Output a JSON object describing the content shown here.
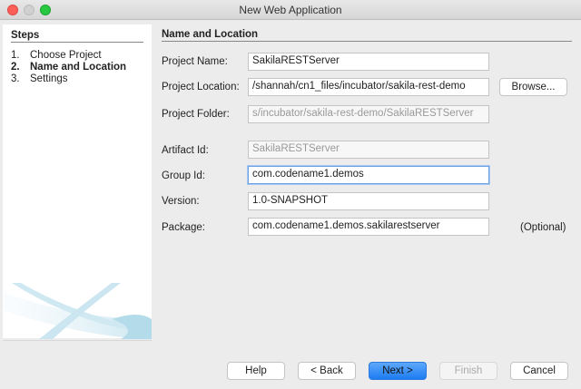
{
  "window": {
    "title": "New Web Application"
  },
  "steps": {
    "heading": "Steps",
    "items": [
      {
        "num": "1.",
        "label": "Choose Project",
        "current": false
      },
      {
        "num": "2.",
        "label": "Name and Location",
        "current": true
      },
      {
        "num": "3.",
        "label": "Settings",
        "current": false
      }
    ]
  },
  "main": {
    "heading": "Name and Location",
    "project_name": {
      "label": "Project Name:",
      "value": "SakilaRESTServer"
    },
    "project_location": {
      "label": "Project Location:",
      "value": "/shannah/cn1_files/incubator/sakila-rest-demo"
    },
    "browse": "Browse...",
    "project_folder": {
      "label": "Project Folder:",
      "value": "s/incubator/sakila-rest-demo/SakilaRESTServer"
    },
    "artifact_id": {
      "label": "Artifact Id:",
      "value": "SakilaRESTServer"
    },
    "group_id": {
      "label": "Group Id:",
      "value": "com.codename1.demos"
    },
    "version": {
      "label": "Version:",
      "value": "1.0-SNAPSHOT"
    },
    "package": {
      "label": "Package:",
      "value": "com.codename1.demos.sakilarestserver",
      "note": "(Optional)"
    }
  },
  "buttons": {
    "help": "Help",
    "back": "< Back",
    "next": "Next >",
    "finish": "Finish",
    "cancel": "Cancel"
  }
}
